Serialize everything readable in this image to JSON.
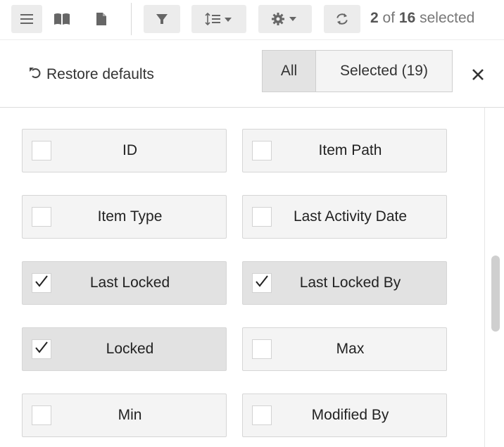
{
  "toolbar": {
    "icons": [
      "list-icon",
      "book-icon",
      "document-icon",
      "filter-icon",
      "sort-icon",
      "gear-icon",
      "refresh-icon"
    ],
    "selection": {
      "count": "2",
      "of_word": "of",
      "total": "16",
      "suffix": "selected"
    }
  },
  "header": {
    "restore_label": "Restore defaults",
    "tabs": {
      "all": "All",
      "selected": "Selected (19)"
    },
    "active_tab": "All"
  },
  "columns": [
    {
      "label": "ID",
      "checked": false
    },
    {
      "label": "Item Path",
      "checked": false
    },
    {
      "label": "Item Type",
      "checked": false
    },
    {
      "label": "Last Activity Date",
      "checked": false
    },
    {
      "label": "Last Locked",
      "checked": true
    },
    {
      "label": "Last Locked By",
      "checked": true
    },
    {
      "label": "Locked",
      "checked": true
    },
    {
      "label": "Max",
      "checked": false
    },
    {
      "label": "Min",
      "checked": false
    },
    {
      "label": "Modified By",
      "checked": false
    }
  ],
  "colors": {
    "button_bg": "#ececec",
    "tile_bg": "#f4f4f4",
    "tile_checked_bg": "#e2e2e2",
    "text": "#222222"
  }
}
